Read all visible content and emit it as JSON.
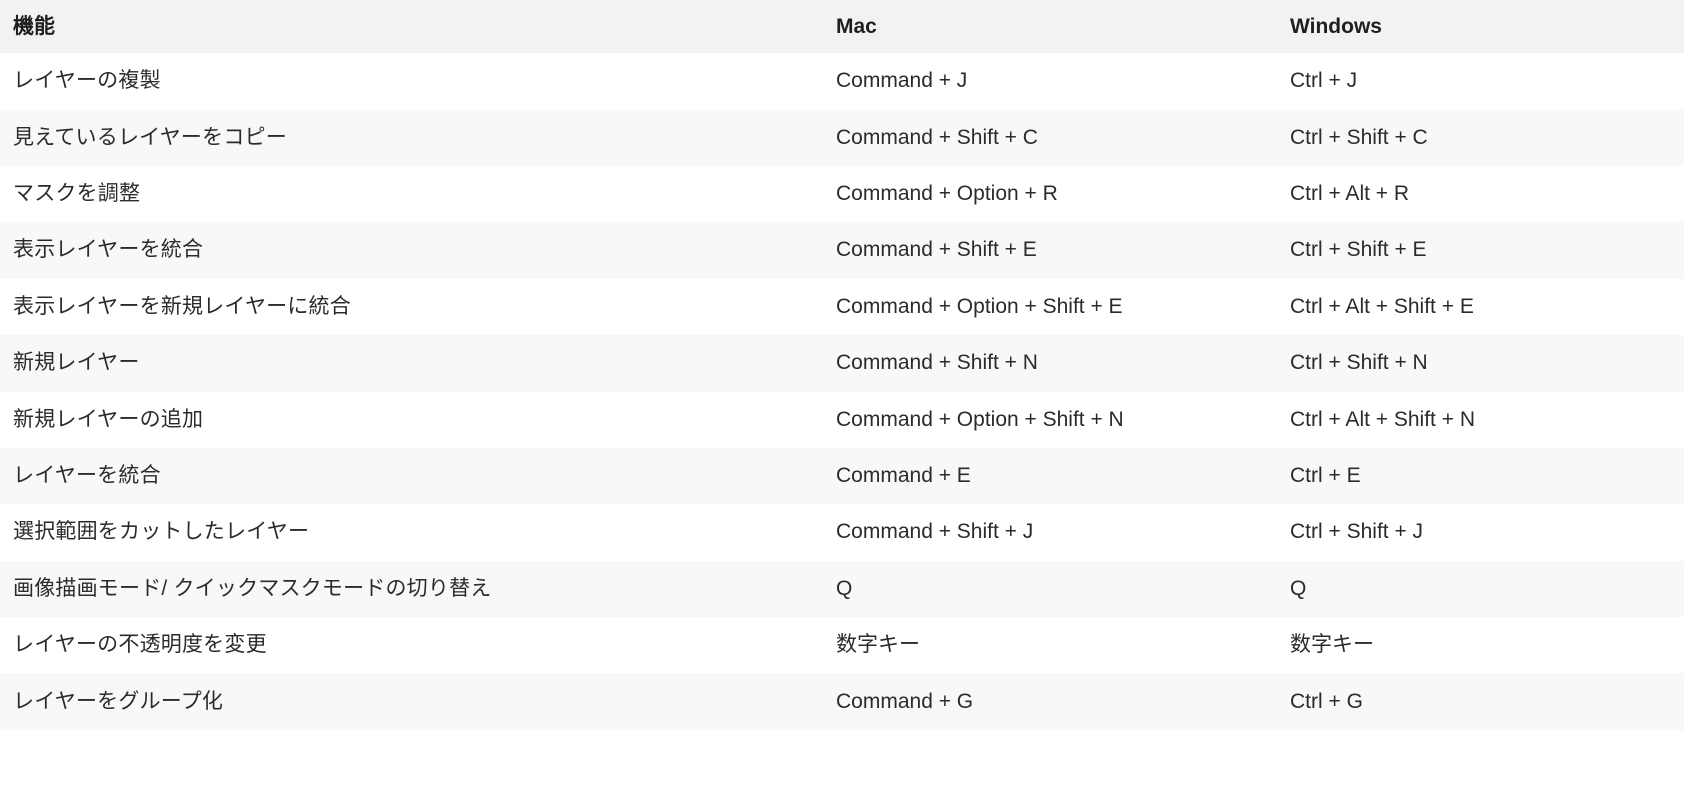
{
  "table": {
    "columns": [
      {
        "key": "feature",
        "label": "機能"
      },
      {
        "key": "mac",
        "label": "Mac"
      },
      {
        "key": "windows",
        "label": "Windows"
      }
    ],
    "rows": [
      {
        "feature": "レイヤーの複製",
        "mac": "Command + J",
        "windows": "Ctrl + J"
      },
      {
        "feature": "見えているレイヤーをコピー",
        "mac": "Command + Shift + C",
        "windows": "Ctrl + Shift + C"
      },
      {
        "feature": "マスクを調整",
        "mac": "Command + Option + R",
        "windows": "Ctrl + Alt + R"
      },
      {
        "feature": "表示レイヤーを統合",
        "mac": "Command + Shift + E",
        "windows": "Ctrl + Shift + E"
      },
      {
        "feature": "表示レイヤーを新規レイヤーに統合",
        "mac": "Command + Option + Shift + E",
        "windows": "Ctrl + Alt + Shift + E"
      },
      {
        "feature": "新規レイヤー",
        "mac": "Command + Shift + N",
        "windows": "Ctrl + Shift + N"
      },
      {
        "feature": "新規レイヤーの追加",
        "mac": "Command + Option + Shift + N",
        "windows": "Ctrl + Alt + Shift + N"
      },
      {
        "feature": "レイヤーを統合",
        "mac": "Command + E",
        "windows": "Ctrl + E"
      },
      {
        "feature": "選択範囲をカットしたレイヤー",
        "mac": "Command + Shift + J",
        "windows": "Ctrl + Shift + J"
      },
      {
        "feature": "画像描画モード/ クイックマスクモードの切り替え",
        "mac": "Q",
        "windows": "Q"
      },
      {
        "feature": "レイヤーの不透明度を変更",
        "mac": "数字キー",
        "windows": "数字キー"
      },
      {
        "feature": "レイヤーをグループ化",
        "mac": "Command + G",
        "windows": "Ctrl + G"
      }
    ]
  },
  "colors": {
    "header_background": "#f2f2f2",
    "row_background": "#ffffff",
    "row_alt_background": "#f8f8f8",
    "header_text": "#1f1f1f",
    "body_text": "#2b2b2b"
  }
}
